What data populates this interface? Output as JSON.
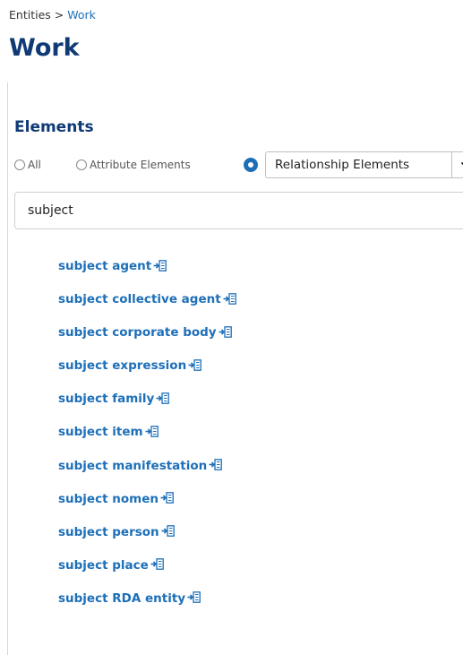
{
  "breadcrumb": {
    "root": "Entities",
    "separator": ">",
    "current": "Work"
  },
  "page_title": "Work",
  "section_title": "Elements",
  "filters": {
    "options": [
      {
        "label": "All",
        "selected": false
      },
      {
        "label": "Attribute Elements",
        "selected": false
      },
      {
        "label": "Relationship Elements",
        "selected": true
      }
    ],
    "dropdown_value": "Relationship Elements"
  },
  "search": {
    "value": "subject",
    "placeholder": ""
  },
  "results": [
    {
      "label": "subject agent",
      "icon": "relationship-icon"
    },
    {
      "label": "subject collective agent",
      "icon": "relationship-icon"
    },
    {
      "label": "subject corporate body",
      "icon": "relationship-icon"
    },
    {
      "label": "subject expression",
      "icon": "relationship-icon"
    },
    {
      "label": "subject family",
      "icon": "relationship-icon"
    },
    {
      "label": "subject item",
      "icon": "relationship-icon"
    },
    {
      "label": "subject manifestation",
      "icon": "relationship-icon"
    },
    {
      "label": "subject nomen",
      "icon": "relationship-icon"
    },
    {
      "label": "subject person",
      "icon": "relationship-icon"
    },
    {
      "label": "subject place",
      "icon": "relationship-icon"
    },
    {
      "label": "subject RDA entity",
      "icon": "relationship-icon"
    }
  ],
  "colors": {
    "heading": "#103a75",
    "link": "#1d6fb8",
    "radio_selected": "#1d6fb8"
  }
}
